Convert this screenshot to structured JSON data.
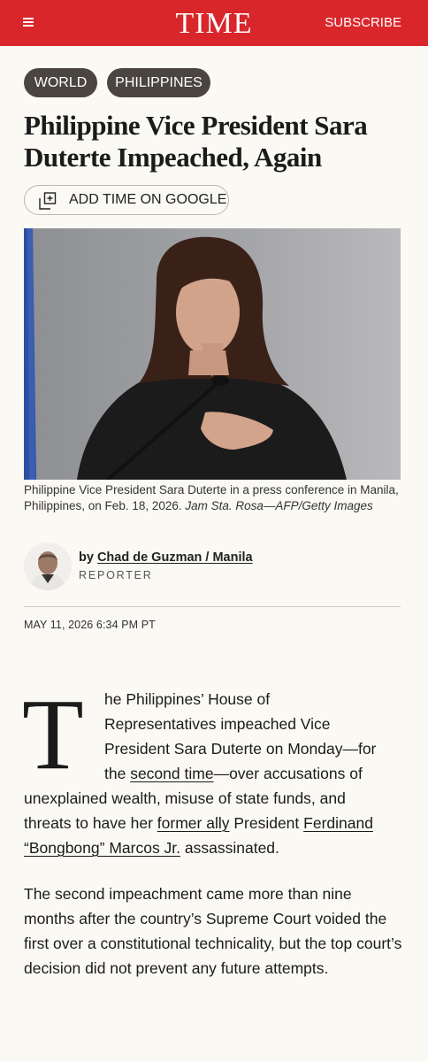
{
  "header": {
    "logo": "TIME",
    "subscribe_label": "SUBSCRIBE"
  },
  "tags": [
    "WORLD",
    "PHILIPPINES"
  ],
  "headline": "Philippine Vice President Sara Duterte Impeached, Again",
  "google_button": {
    "label": "ADD TIME ON GOOGLE",
    "icon": "add-source-icon"
  },
  "image": {
    "caption": "Philippine Vice President Sara Duterte in a press conference in Manila, Philippines, on Feb. 18, 2026.",
    "credit": "Jam Sta. Rosa—AFP/Getty Images"
  },
  "byline": {
    "by": "by",
    "author": "Chad de Guzman / Manila",
    "role": "REPORTER"
  },
  "dateline": "MAY 11, 2026 6:34 PM PT",
  "article": {
    "drop_cap": "T",
    "para1": {
      "line1": "he Philippines’ House of",
      "line2": "Representatives impeached Vice",
      "line3": "President Sara Duterte on Monday—for",
      "line4_pre": "the ",
      "line4_link": "second time",
      "line4_post": "—over accusations of",
      "line5": "unexplained wealth, misuse of state funds, and",
      "line6_pre": "threats to have her ",
      "line6_link1": "former ally",
      "line6_mid": " President ",
      "line6_link2": "Ferdinand",
      "line7_link": "“Bongbong” Marcos Jr.",
      "line7_post": " assassinated."
    },
    "para2": "The second impeachment came more than nine months after the country’s Supreme Court voided the first over a constitutional technicality, but the top court’s decision did not prevent any future attempts."
  }
}
